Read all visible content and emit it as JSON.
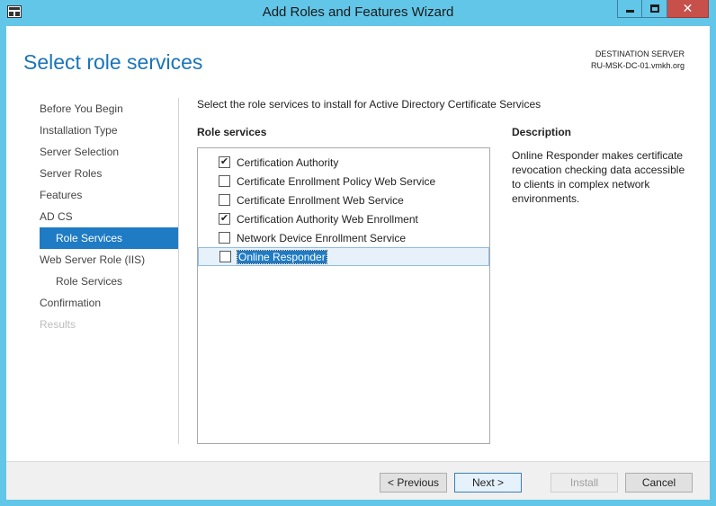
{
  "window": {
    "title": "Add Roles and Features Wizard",
    "close_glyph": "✕"
  },
  "header": {
    "page_title": "Select role services",
    "destination_label": "DESTINATION SERVER",
    "destination_server": "RU-MSK-DC-01.vmkh.org"
  },
  "nav": {
    "items": [
      {
        "label": "Before You Begin"
      },
      {
        "label": "Installation Type"
      },
      {
        "label": "Server Selection"
      },
      {
        "label": "Server Roles"
      },
      {
        "label": "Features"
      },
      {
        "label": "AD CS"
      },
      {
        "label": "Role Services"
      },
      {
        "label": "Web Server Role (IIS)"
      },
      {
        "label": "Role Services"
      },
      {
        "label": "Confirmation"
      },
      {
        "label": "Results"
      }
    ]
  },
  "main": {
    "instruction": "Select the role services to install for Active Directory Certificate Services",
    "role_services_heading": "Role services",
    "description_heading": "Description",
    "description_text": "Online Responder makes certificate revocation checking data accessible to clients in complex network environments.",
    "role_services": [
      {
        "label": "Certification Authority",
        "checked": true
      },
      {
        "label": "Certificate Enrollment Policy Web Service",
        "checked": false
      },
      {
        "label": "Certificate Enrollment Web Service",
        "checked": false
      },
      {
        "label": "Certification Authority Web Enrollment",
        "checked": true
      },
      {
        "label": "Network Device Enrollment Service",
        "checked": false
      },
      {
        "label": "Online Responder",
        "checked": false
      }
    ],
    "check_glyph": "✔"
  },
  "footer": {
    "previous_label": "< Previous",
    "next_label": "Next >",
    "install_label": "Install",
    "cancel_label": "Cancel"
  },
  "colors": {
    "title_blue": "#1a74b8",
    "selection_blue": "#1f7bc4",
    "window_frame": "#62c6e8",
    "close_red": "#c7504a"
  }
}
